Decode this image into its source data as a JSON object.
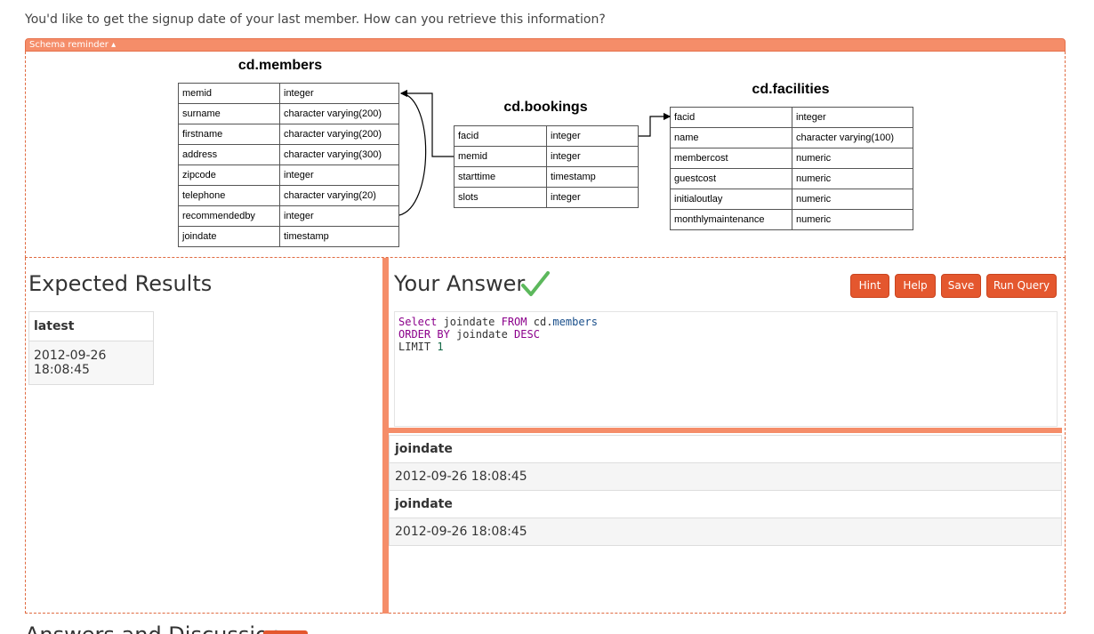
{
  "question": "You'd like to get the signup date of your last member. How can you retrieve this information?",
  "schema_toggle": "Schema reminder ▴",
  "schema": {
    "members": {
      "title": "cd.members",
      "rows": [
        [
          "memid",
          "integer"
        ],
        [
          "surname",
          "character varying(200)"
        ],
        [
          "firstname",
          "character varying(200)"
        ],
        [
          "address",
          "character varying(300)"
        ],
        [
          "zipcode",
          "integer"
        ],
        [
          "telephone",
          "character varying(20)"
        ],
        [
          "recommendedby",
          "integer"
        ],
        [
          "joindate",
          "timestamp"
        ]
      ]
    },
    "bookings": {
      "title": "cd.bookings",
      "rows": [
        [
          "facid",
          "integer"
        ],
        [
          "memid",
          "integer"
        ],
        [
          "starttime",
          "timestamp"
        ],
        [
          "slots",
          "integer"
        ]
      ]
    },
    "facilities": {
      "title": "cd.facilities",
      "rows": [
        [
          "facid",
          "integer"
        ],
        [
          "name",
          "character varying(100)"
        ],
        [
          "membercost",
          "numeric"
        ],
        [
          "guestcost",
          "numeric"
        ],
        [
          "initialoutlay",
          "numeric"
        ],
        [
          "monthlymaintenance",
          "numeric"
        ]
      ]
    }
  },
  "expected": {
    "heading": "Expected Results",
    "column": "latest",
    "value": "2012-09-26 18:08:45"
  },
  "answer": {
    "heading": "Your Answer",
    "buttons": {
      "hint": "Hint",
      "help": "Help",
      "save": "Save",
      "run": "Run Query"
    },
    "query": {
      "line1_kw": "Select",
      "line1_a": " joindate ",
      "line1_kw2": "FROM",
      "line1_b": " cd.",
      "line1_ident": "members",
      "line2_kw": "ORDER BY",
      "line2_a": " joindate ",
      "line2_kw2": "DESC",
      "line3_a": "LIMIT ",
      "line3_num": "1"
    },
    "results": [
      {
        "column": "joindate",
        "value": "2012-09-26 18:08:45"
      },
      {
        "column": "joindate",
        "value": "2012-09-26 18:08:45"
      }
    ]
  },
  "bottom_heading": "Answers and Discussion",
  "colors": {
    "accent": "#e4572e",
    "splitter": "#f58d69",
    "check": "#5cb85c"
  }
}
